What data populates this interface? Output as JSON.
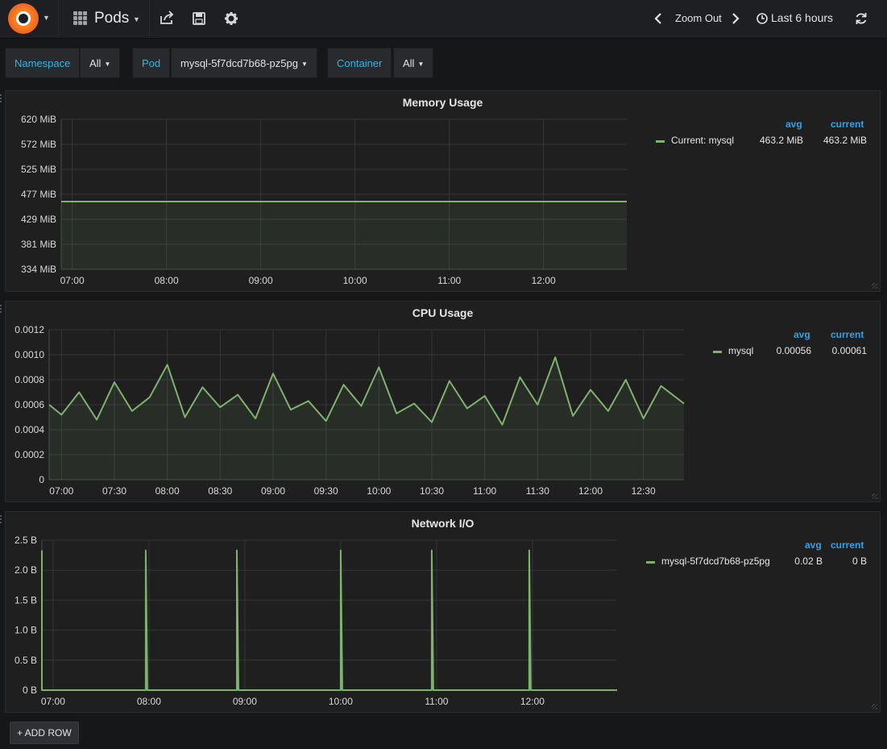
{
  "navbar": {
    "dashboard_title": "Pods",
    "zoom_out": "Zoom Out",
    "time_range": "Last 6 hours"
  },
  "variables": [
    {
      "label": "Namespace",
      "value": "All"
    },
    {
      "label": "Pod",
      "value": "mysql-5f7dcd7b68-pz5pg"
    },
    {
      "label": "Container",
      "value": "All"
    }
  ],
  "add_row_label": "+ ADD ROW",
  "colors": {
    "series": "#7eb26d",
    "accent": "#33b5e5"
  },
  "chart_data": [
    {
      "type": "area",
      "title": "Memory Usage",
      "ylim": [
        334,
        620
      ],
      "y_ticks": [
        "334 MiB",
        "381 MiB",
        "429 MiB",
        "477 MiB",
        "525 MiB",
        "572 MiB",
        "620 MiB"
      ],
      "x_ticks": [
        "07:00",
        "08:00",
        "09:00",
        "10:00",
        "11:00",
        "12:00"
      ],
      "x_range": [
        "06:53",
        "12:53"
      ],
      "grid": true,
      "series": [
        {
          "name": "Current: mysql",
          "x": [
            "06:53",
            "12:53"
          ],
          "values": [
            463.2,
            463.2
          ],
          "avg": "463.2 MiB",
          "current": "463.2 MiB"
        }
      ],
      "legend_columns": [
        "avg",
        "current"
      ],
      "legend_position": "right"
    },
    {
      "type": "area",
      "title": "CPU Usage",
      "ylim": [
        0,
        0.0012
      ],
      "y_ticks": [
        "0",
        "0.0002",
        "0.0004",
        "0.0006",
        "0.0008",
        "0.0010",
        "0.0012"
      ],
      "x_ticks": [
        "07:00",
        "07:30",
        "08:00",
        "08:30",
        "09:00",
        "09:30",
        "10:00",
        "10:30",
        "11:00",
        "11:30",
        "12:00",
        "12:30"
      ],
      "x_range": [
        "06:53",
        "12:53"
      ],
      "grid": true,
      "series": [
        {
          "name": "mysql",
          "avg": "0.00056",
          "current": "0.00061",
          "x": [
            "06:53",
            "07:00",
            "07:10",
            "07:20",
            "07:30",
            "07:40",
            "07:50",
            "08:00",
            "08:10",
            "08:20",
            "08:30",
            "08:40",
            "08:50",
            "09:00",
            "09:10",
            "09:20",
            "09:30",
            "09:40",
            "09:50",
            "10:00",
            "10:10",
            "10:20",
            "10:30",
            "10:40",
            "10:50",
            "11:00",
            "11:10",
            "11:20",
            "11:30",
            "11:40",
            "11:50",
            "12:00",
            "12:10",
            "12:20",
            "12:30",
            "12:40",
            "12:53"
          ],
          "values": [
            0.0006,
            0.00052,
            0.0007,
            0.00048,
            0.00078,
            0.00055,
            0.00066,
            0.00092,
            0.0005,
            0.00074,
            0.00058,
            0.00068,
            0.00049,
            0.00085,
            0.00056,
            0.00063,
            0.00047,
            0.00076,
            0.00059,
            0.0009,
            0.00053,
            0.00061,
            0.00046,
            0.00079,
            0.00057,
            0.00067,
            0.00044,
            0.00082,
            0.0006,
            0.00098,
            0.00051,
            0.00072,
            0.00055,
            0.0008,
            0.00049,
            0.00075,
            0.00061
          ]
        }
      ],
      "legend_columns": [
        "avg",
        "current"
      ],
      "legend_position": "right"
    },
    {
      "type": "line",
      "title": "Network I/O",
      "ylim": [
        0,
        2.5
      ],
      "y_ticks": [
        "0 B",
        "0.5 B",
        "1.0 B",
        "1.5 B",
        "2.0 B",
        "2.5 B"
      ],
      "x_ticks": [
        "07:00",
        "08:00",
        "09:00",
        "10:00",
        "11:00",
        "12:00"
      ],
      "x_range": [
        "06:53",
        "12:53"
      ],
      "grid": true,
      "series": [
        {
          "name": "mysql-5f7dcd7b68-pz5pg",
          "avg": "0.02 B",
          "current": "0 B",
          "x": [
            "06:53",
            "06:53",
            "06:54",
            "07:58",
            "07:58",
            "07:59",
            "08:55",
            "08:55",
            "08:56",
            "10:00",
            "10:00",
            "10:01",
            "10:57",
            "10:57",
            "10:58",
            "11:58",
            "11:58",
            "11:59",
            "12:53"
          ],
          "values": [
            2.33,
            0,
            0,
            0,
            2.33,
            0,
            0,
            2.33,
            0,
            0,
            2.33,
            0,
            0,
            2.33,
            0,
            0,
            2.33,
            0,
            0
          ]
        }
      ],
      "legend_columns": [
        "avg",
        "current"
      ],
      "legend_position": "right"
    }
  ]
}
